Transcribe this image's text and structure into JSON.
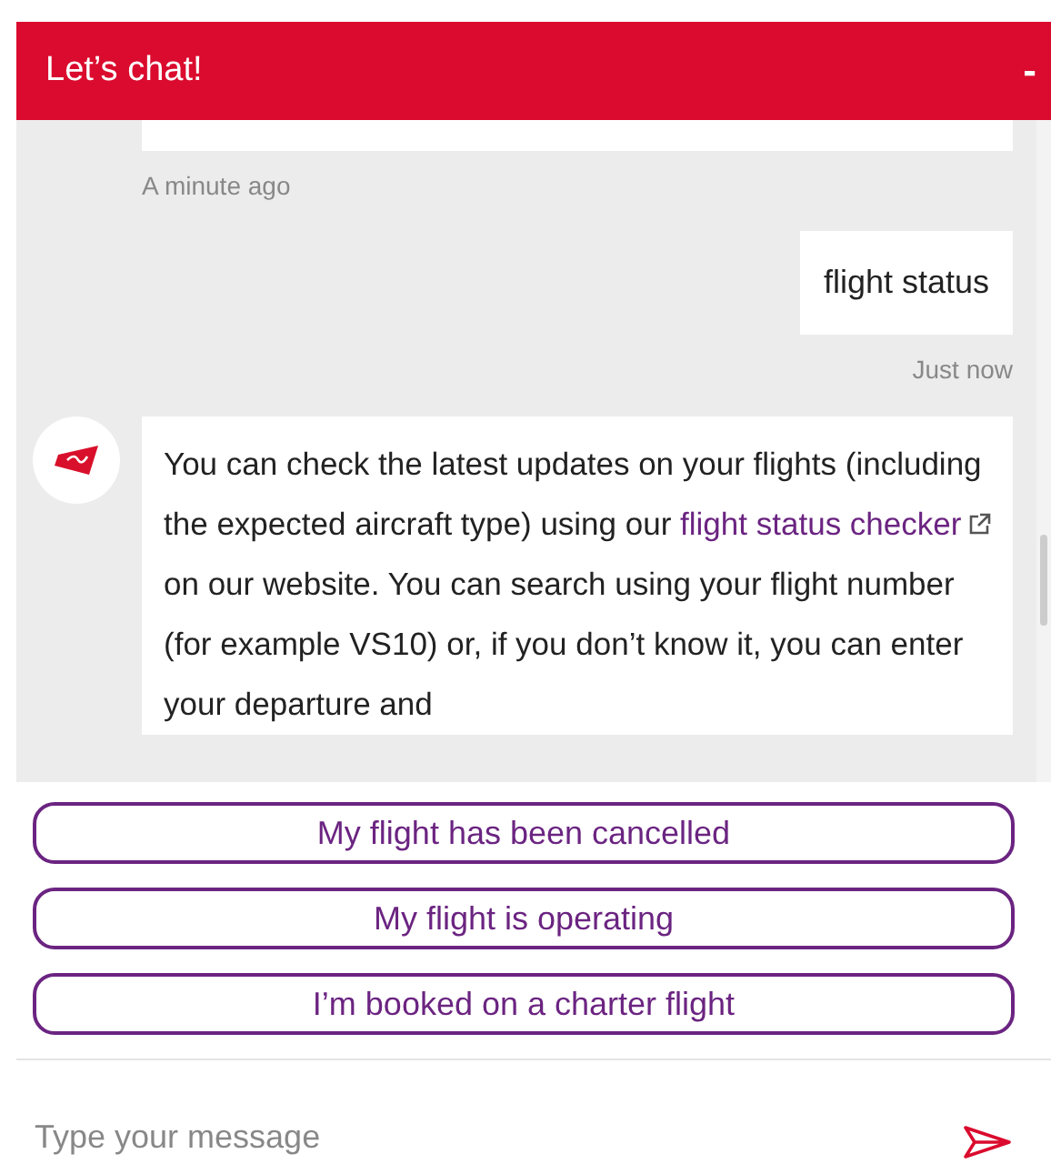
{
  "header": {
    "title": "Let’s chat!",
    "minimize": "-"
  },
  "messages": [
    {
      "kind": "bot_cut",
      "time": "A minute ago"
    },
    {
      "kind": "user",
      "text": "flight status",
      "time": "Just now"
    },
    {
      "kind": "bot",
      "before": "You can check the latest updates on your flights (including the expected aircraft type) using our ",
      "link": "flight status checker",
      "after": " on our website. You can search using your flight number (for example VS10) or, if you don’t know it, you can enter your departure and"
    }
  ],
  "quick_replies": [
    "My flight has been cancelled",
    "My flight is operating",
    "I’m booked on a charter flight"
  ],
  "input": {
    "placeholder": "Type your message"
  }
}
